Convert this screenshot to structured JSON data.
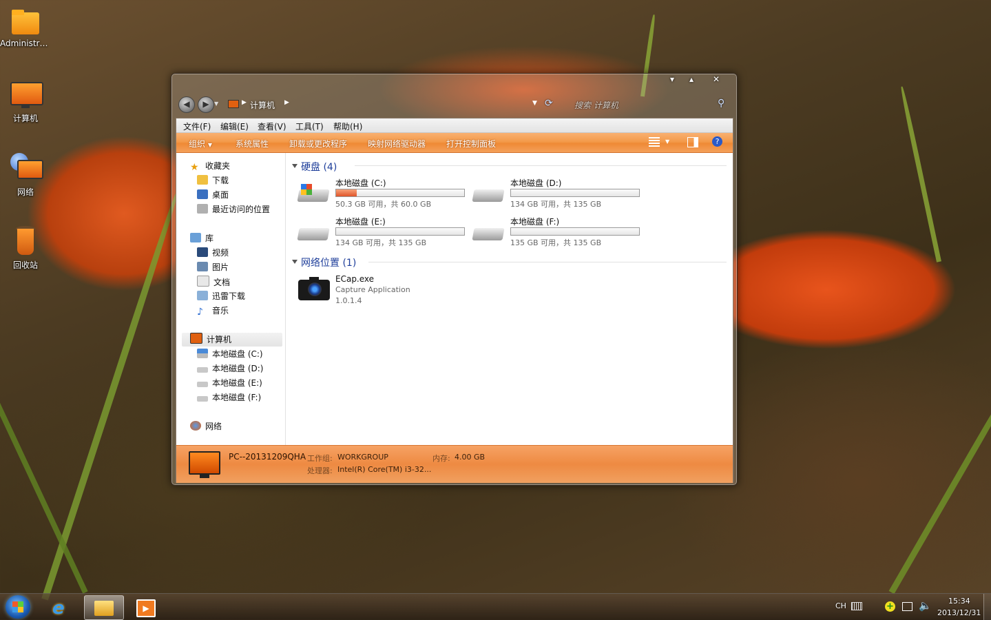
{
  "desktop": {
    "icons": [
      {
        "label": "Administra..."
      },
      {
        "label": "计算机"
      },
      {
        "label": "网络"
      },
      {
        "label": "回收站"
      }
    ]
  },
  "window": {
    "controls": {
      "minimize": "▾",
      "maximize": "▴",
      "close": "✕"
    },
    "breadcrumb": [
      "计算机"
    ],
    "search_placeholder": "搜索 计算机",
    "menu": [
      "文件(F)",
      "编辑(E)",
      "查看(V)",
      "工具(T)",
      "帮助(H)"
    ],
    "toolbar": [
      "组织",
      "系统属性",
      "卸载或更改程序",
      "映射网络驱动器",
      "打开控制面板"
    ],
    "nav": {
      "favorites": {
        "label": "收藏夹",
        "items": [
          "下载",
          "桌面",
          "最近访问的位置"
        ]
      },
      "libraries": {
        "label": "库",
        "items": [
          "视频",
          "图片",
          "文档",
          "迅雷下载",
          "音乐"
        ]
      },
      "computer": {
        "label": "计算机",
        "items": [
          "本地磁盘 (C:)",
          "本地磁盘 (D:)",
          "本地磁盘 (E:)",
          "本地磁盘 (F:)"
        ]
      },
      "network": {
        "label": "网络"
      }
    },
    "groups": {
      "hdd": {
        "title": "硬盘 (4)"
      },
      "network": {
        "title": "网络位置 (1)"
      }
    },
    "drives": [
      {
        "name": "本地磁盘 (C:)",
        "free": "50.3 GB 可用，共 60.0 GB",
        "used_fraction": 0.16
      },
      {
        "name": "本地磁盘 (D:)",
        "free": "134 GB 可用，共 135 GB",
        "used_fraction": 0.0
      },
      {
        "name": "本地磁盘 (E:)",
        "free": "134 GB 可用，共 135 GB",
        "used_fraction": 0.0
      },
      {
        "name": "本地磁盘 (F:)",
        "free": "135 GB 可用，共 135 GB",
        "used_fraction": 0.0
      }
    ],
    "netitem": {
      "name": "ECap.exe",
      "desc": "Capture Application",
      "version": "1.0.1.4"
    },
    "status": {
      "pc_name": "PC--20131209QHA",
      "workgroup_label": "工作组:",
      "workgroup": "WORKGROUP",
      "memory_label": "内存:",
      "memory": "4.00 GB",
      "cpu_label": "处理器:",
      "cpu": "Intel(R) Core(TM) i3-32..."
    }
  },
  "taskbar": {
    "lang": "CH",
    "time": "15:34",
    "date": "2013/12/31"
  },
  "colors": {
    "accent": "#ef8a35",
    "link": "#1e3e9a"
  }
}
